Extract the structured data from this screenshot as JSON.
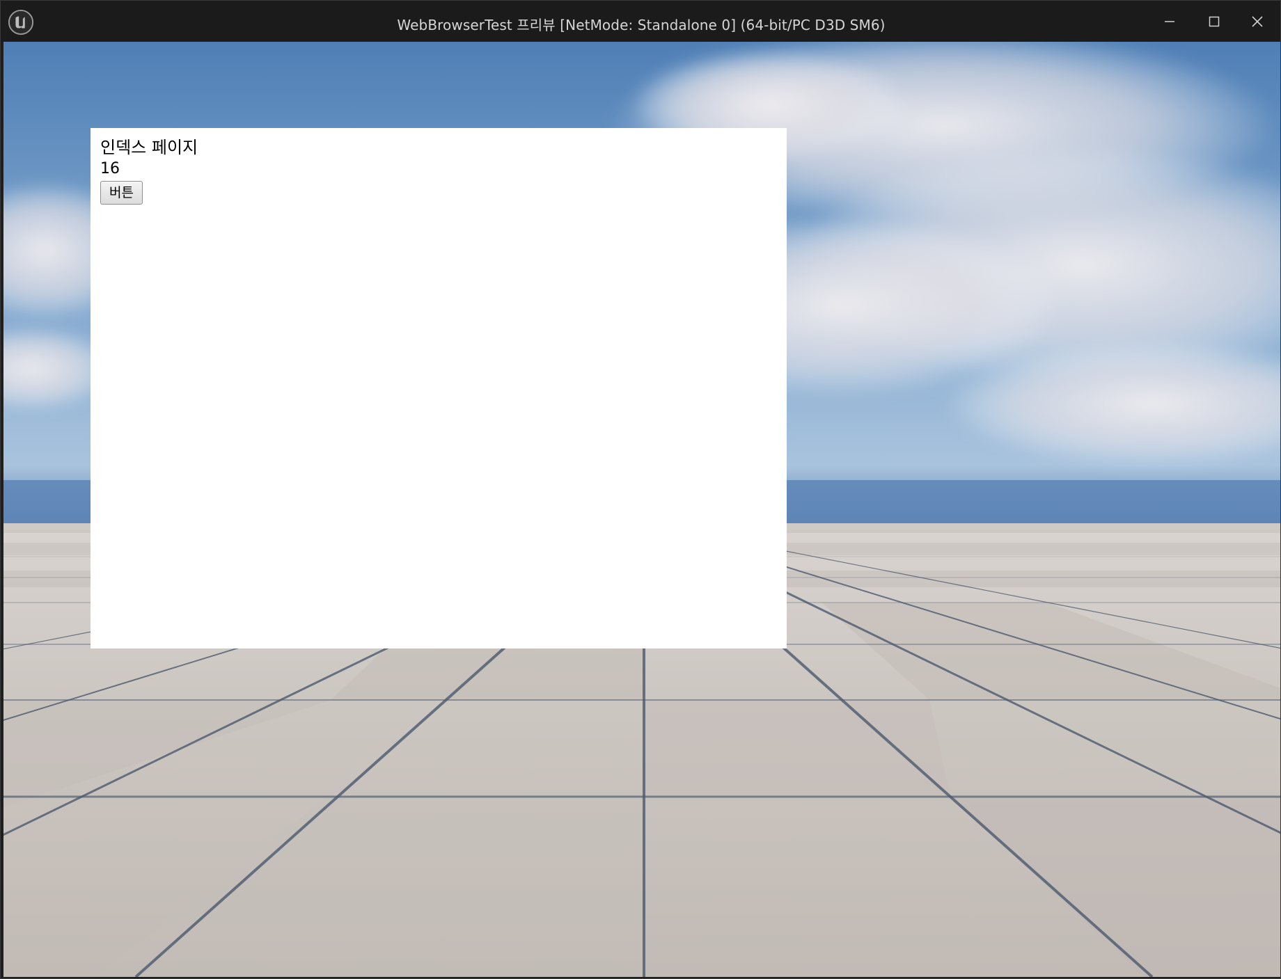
{
  "window": {
    "title": "WebBrowserTest 프리뷰 [NetMode: Standalone 0]  (64-bit/PC D3D SM6)",
    "app_icon": "unreal-engine-logo-icon",
    "controls": {
      "minimize_icon": "minimize-icon",
      "maximize_icon": "maximize-icon",
      "close_icon": "close-icon"
    }
  },
  "web_page": {
    "heading": "인덱스 페이지",
    "counter": "16",
    "button_label": "버튼"
  },
  "colors": {
    "titlebar": "#1b1b1b",
    "sky_top": "#4f7fb6",
    "floor": "#cfc9c4",
    "panel": "#ffffff"
  }
}
